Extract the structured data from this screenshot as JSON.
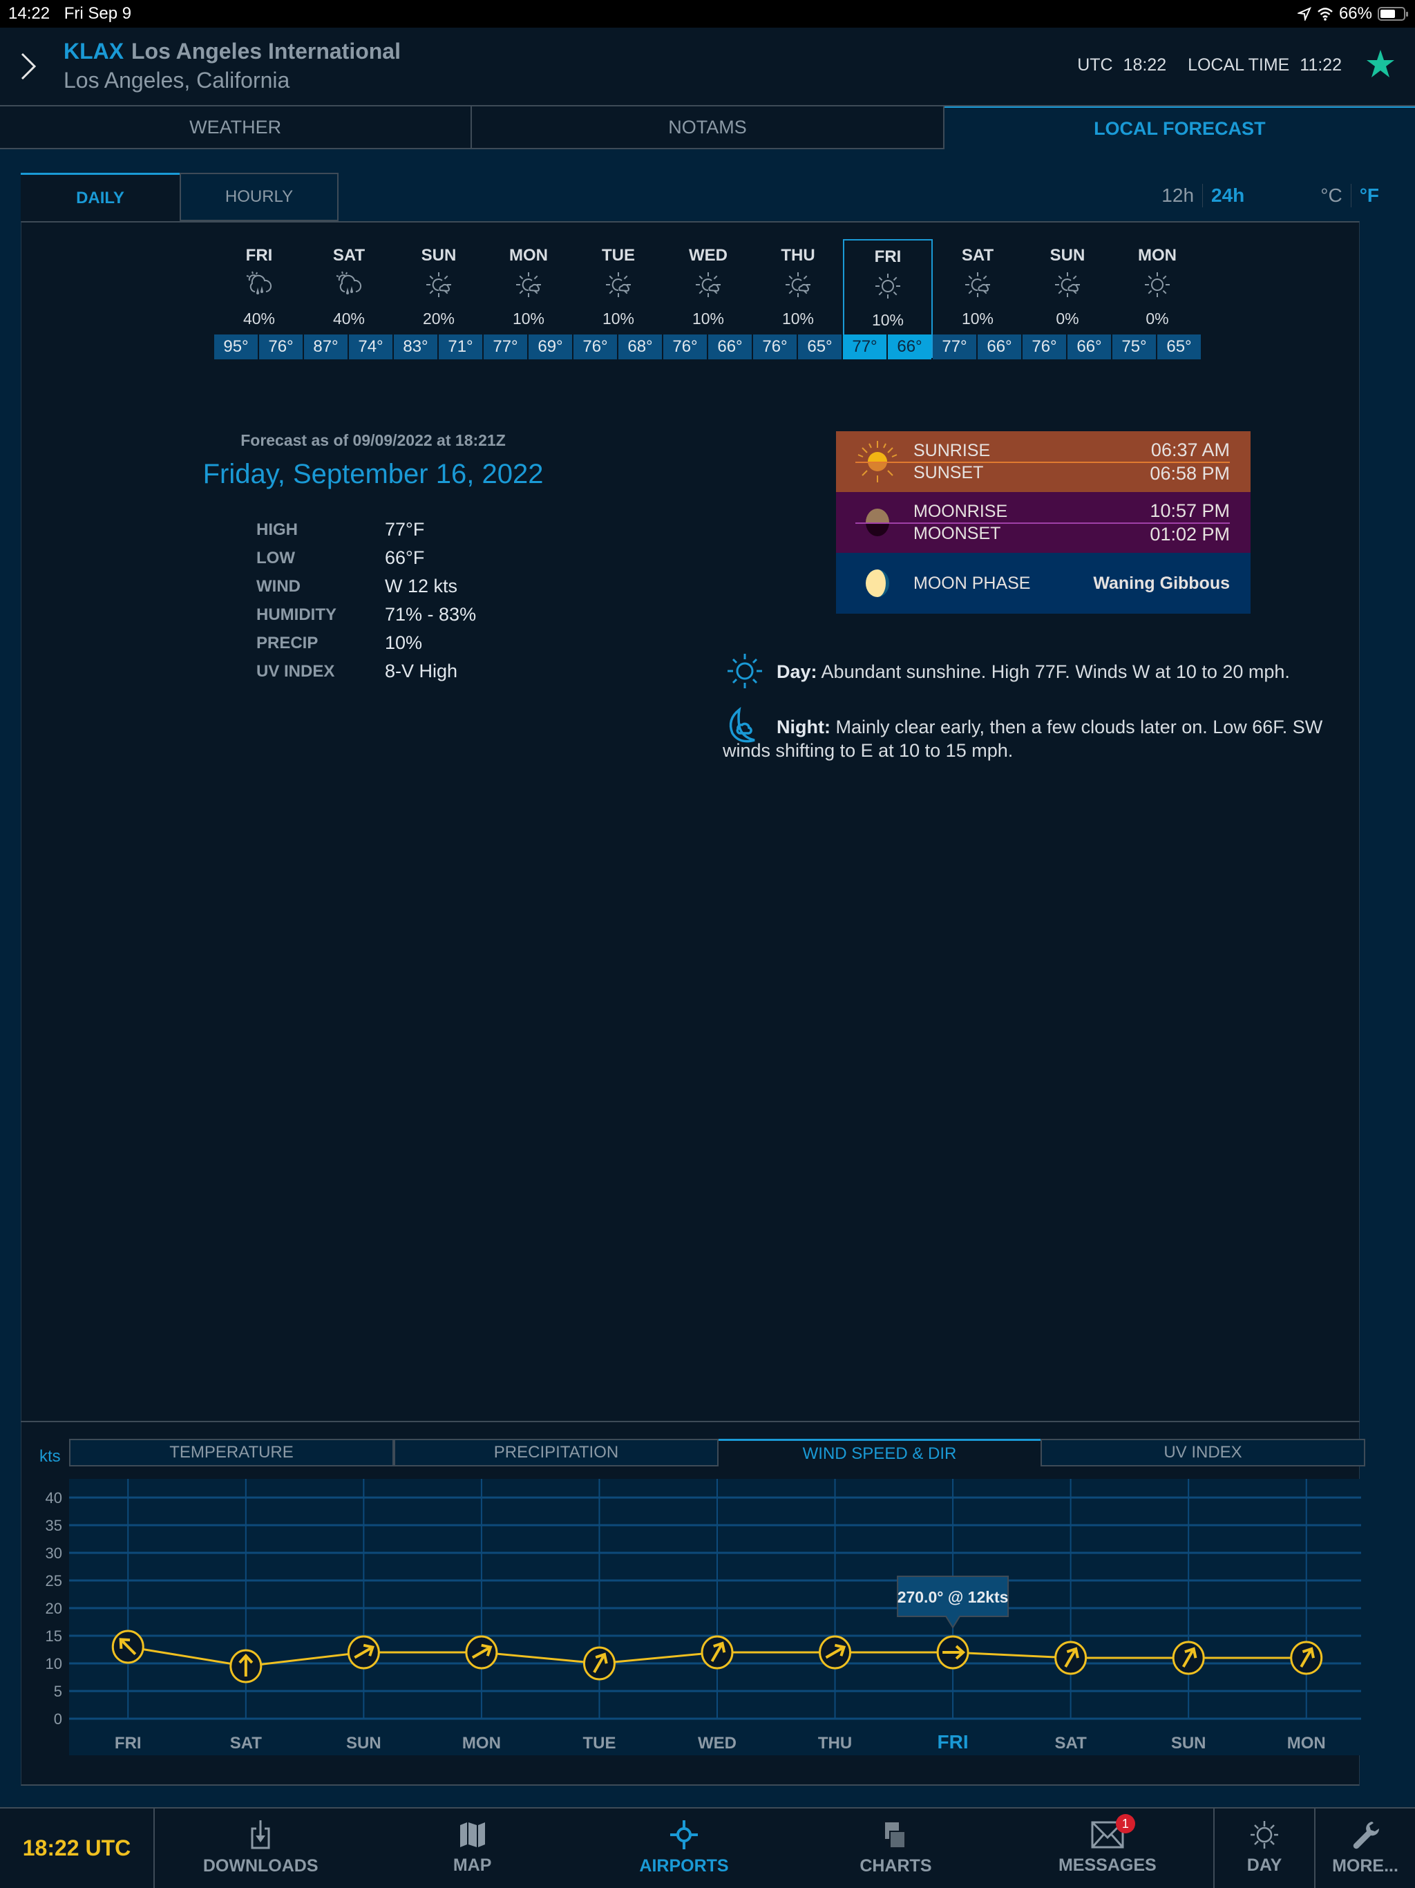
{
  "status_bar": {
    "time": "14:22",
    "date": "Fri Sep 9",
    "battery": "66%",
    "battery_level": 0.66
  },
  "header": {
    "airport_code": "KLAX",
    "airport_name": "Los Angeles International",
    "city": "Los Angeles, California",
    "utc_label": "UTC",
    "utc_time": "18:22",
    "local_label": "LOCAL TIME",
    "local_time": "11:22",
    "favorite": true
  },
  "main_tabs": [
    {
      "label": "WEATHER",
      "active": false
    },
    {
      "label": "NOTAMS",
      "active": false
    },
    {
      "label": "LOCAL FORECAST",
      "active": true
    }
  ],
  "sub_tabs": [
    {
      "label": "DAILY",
      "active": true
    },
    {
      "label": "HOURLY",
      "active": false
    }
  ],
  "toggles": {
    "h12": "12h",
    "h24": "24h",
    "celsius": "°C",
    "fahrenheit": "°F",
    "time_format": "24h",
    "unit": "°F"
  },
  "days": [
    {
      "day": "FRI",
      "icon": "cloud-rain-sun-icon",
      "precip": "40%",
      "high": "95°",
      "low": "76°"
    },
    {
      "day": "SAT",
      "icon": "cloud-rain-sun-icon",
      "precip": "40%",
      "high": "87°",
      "low": "74°"
    },
    {
      "day": "SUN",
      "icon": "partly-cloudy-icon",
      "precip": "20%",
      "high": "83°",
      "low": "71°"
    },
    {
      "day": "MON",
      "icon": "partly-cloudy-icon",
      "precip": "10%",
      "high": "77°",
      "low": "69°"
    },
    {
      "day": "TUE",
      "icon": "partly-cloudy-icon",
      "precip": "10%",
      "high": "76°",
      "low": "68°"
    },
    {
      "day": "WED",
      "icon": "partly-cloudy-icon",
      "precip": "10%",
      "high": "76°",
      "low": "66°"
    },
    {
      "day": "THU",
      "icon": "partly-cloudy-icon",
      "precip": "10%",
      "high": "76°",
      "low": "65°"
    },
    {
      "day": "FRI",
      "icon": "sun-icon",
      "precip": "10%",
      "high": "77°",
      "low": "66°",
      "selected": true
    },
    {
      "day": "SAT",
      "icon": "partly-cloudy-icon",
      "precip": "10%",
      "high": "77°",
      "low": "66°"
    },
    {
      "day": "SUN",
      "icon": "partly-cloudy-icon",
      "precip": "0%",
      "high": "76°",
      "low": "66°"
    },
    {
      "day": "MON",
      "icon": "sun-icon",
      "precip": "0%",
      "high": "75°",
      "low": "65°"
    }
  ],
  "detail": {
    "as_of": "Forecast as of 09/09/2022 at 18:21Z",
    "date": "Friday, September 16, 2022",
    "stats": [
      {
        "label": "HIGH",
        "value": "77°F"
      },
      {
        "label": "LOW",
        "value": "66°F"
      },
      {
        "label": "WIND",
        "value": "W 12 kts"
      },
      {
        "label": "HUMIDITY",
        "value": "71% - 83%"
      },
      {
        "label": "PRECIP",
        "value": "10%"
      },
      {
        "label": "UV INDEX",
        "value": "8-V High"
      }
    ]
  },
  "astro": {
    "sunrise_label": "SUNRISE",
    "sunrise": "06:37 AM",
    "sunset_label": "SUNSET",
    "sunset": "06:58 PM",
    "moonrise_label": "MOONRISE",
    "moonrise": "10:57 PM",
    "moonset_label": "MOONSET",
    "moonset": "01:02 PM",
    "phase_label": "MOON PHASE",
    "phase": "Waning Gibbous",
    "colors": {
      "sun": "#93462b",
      "moon": "#470b45",
      "phase": "#003060"
    }
  },
  "narrative": {
    "day_label": "Day:",
    "day_text": " Abundant sunshine. High 77F. Winds W at 10 to 20 mph.",
    "night_label": "Night:",
    "night_text": " Mainly clear early, then a few clouds later on. Low 66F. SW winds shifting to E at 10 to 15 mph."
  },
  "chart_tabs": [
    {
      "label": "TEMPERATURE",
      "active": false
    },
    {
      "label": "PRECIPITATION",
      "active": false
    },
    {
      "label": "WIND SPEED & DIR",
      "active": true
    },
    {
      "label": "UV INDEX",
      "active": false
    }
  ],
  "chart_data": {
    "type": "line",
    "title": "WIND SPEED & DIR",
    "ylabel": "kts",
    "xlabel": "",
    "ylim": [
      0,
      40
    ],
    "yticks": [
      0,
      5,
      10,
      15,
      20,
      25,
      30,
      35,
      40
    ],
    "grid": true,
    "categories": [
      "FRI",
      "SAT",
      "SUN",
      "MON",
      "TUE",
      "WED",
      "THU",
      "FRI",
      "SAT",
      "SUN",
      "MON"
    ],
    "selected_index": 7,
    "series": [
      {
        "name": "Wind speed",
        "values": [
          13,
          9.5,
          12,
          12,
          10,
          12,
          12,
          12,
          11,
          11,
          11
        ],
        "directions_deg": [
          135,
          180,
          240,
          240,
          210,
          210,
          240,
          270,
          210,
          210,
          210
        ]
      }
    ],
    "tooltip": "270.0° @ 12kts",
    "colors": {
      "line": "#f0c020",
      "grid": "#0d4a7a",
      "plot_bg": "#02223a",
      "selected_label": "#1a9ad6"
    }
  },
  "bottom_nav": {
    "clock": "18:22 UTC",
    "items": [
      {
        "label": "DOWNLOADS",
        "icon": "download-icon",
        "active": false
      },
      {
        "label": "MAP",
        "icon": "map-icon",
        "active": false
      },
      {
        "label": "AIRPORTS",
        "icon": "airport-icon",
        "active": true
      },
      {
        "label": "CHARTS",
        "icon": "charts-icon",
        "active": false
      },
      {
        "label": "MESSAGES",
        "icon": "mail-icon",
        "active": false,
        "badge": "1"
      }
    ],
    "day_label": "DAY",
    "more_label": "MORE..."
  }
}
